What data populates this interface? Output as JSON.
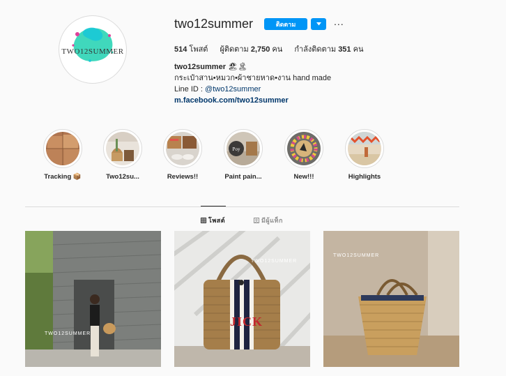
{
  "profile": {
    "username": "two12summer",
    "avatar_brand": "TWO12SUMMER",
    "follow_label": "ติดตาม",
    "more_icon": "...",
    "stats": {
      "posts_count": "514",
      "posts_label": "โพสต์",
      "followers_label": "ผู้ติดตาม",
      "followers_count": "2,750",
      "followers_unit": "คน",
      "following_label": "กำลังติดตาม",
      "following_count": "351",
      "following_unit": "คน"
    },
    "bio": {
      "name": "two12summer",
      "name_emoji": "🏖🏝",
      "description": "กระเป๋าสาน•หมวก•ผ้าชายหาด•งาน hand made",
      "line_prefix": "Line ID : ",
      "line_handle": "@two12summer",
      "website": "m.facebook.com/two12summer"
    }
  },
  "highlights": [
    {
      "label": "Tracking 📦"
    },
    {
      "label": "Two12su..."
    },
    {
      "label": "Reviews!!"
    },
    {
      "label": "Paint pain..."
    },
    {
      "label": "New!!!"
    },
    {
      "label": "Highlights"
    }
  ],
  "tabs": {
    "posts": "โพสต์",
    "tagged": "มีผู้แท็ก"
  },
  "posts": [
    {
      "watermark": "TWO12SUMMER"
    },
    {
      "watermark": "TWO12SUMMER",
      "bag_text": "JICK"
    },
    {
      "watermark": "TWO12SUMMER"
    }
  ],
  "colors": {
    "accent": "#0095f6",
    "link": "#00376b",
    "background": "#fafafa",
    "border": "#dbdbdb"
  }
}
